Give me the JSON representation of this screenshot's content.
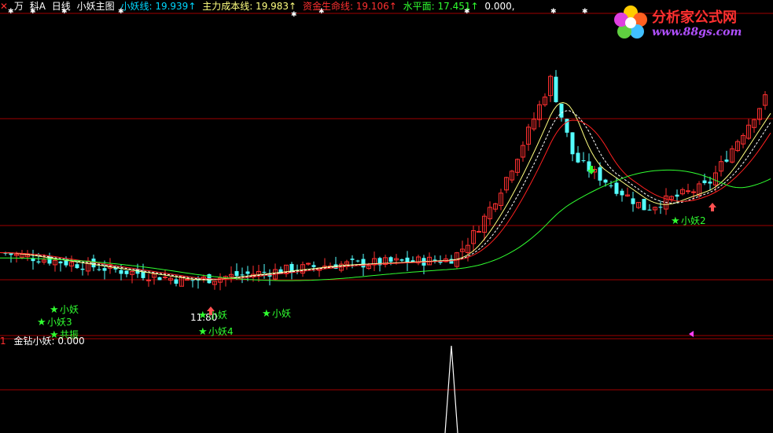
{
  "header": {
    "icon": "close-icon",
    "items": [
      {
        "text": "万",
        "color": "#ffffff"
      },
      {
        "text": "科A",
        "color": "#ffffff"
      },
      {
        "text": "日线",
        "color": "#ffffff"
      },
      {
        "text": "小妖主图",
        "color": "#ffffff"
      },
      {
        "text": "小妖线: 19.939↑",
        "color": "#00d8ff"
      },
      {
        "text": "主力成本线: 19.983↑",
        "color": "#ffff80"
      },
      {
        "text": "资金生命线: 19.106↑",
        "color": "#ff3030"
      },
      {
        "text": "水平面: 17.451↑",
        "color": "#30ff30"
      },
      {
        "text": "0.000,",
        "color": "#ffffff"
      }
    ]
  },
  "sub_panel": {
    "index": "1",
    "name": "金钻小妖: 0.000"
  },
  "logo": {
    "title": "分析家公式网",
    "url": "www.88gs.com"
  },
  "chart_data": {
    "type": "candlestick",
    "panels": [
      "main",
      "indicator"
    ],
    "price_range_approx": [
      9,
      27
    ],
    "series": [
      {
        "name": "小妖线",
        "color": "#ffff80"
      },
      {
        "name": "主力成本线",
        "color": "#ffffff"
      },
      {
        "name": "资金生命线",
        "color": "#ff2020"
      },
      {
        "name": "水平面",
        "color": "#30ff30"
      }
    ],
    "annotations": [
      {
        "text": "小妖"
      },
      {
        "text": "小妖3"
      },
      {
        "text": "共振"
      },
      {
        "text": "11.80"
      },
      {
        "text": "小妖"
      },
      {
        "text": "小妖4"
      },
      {
        "text": "小妖"
      },
      {
        "text": "小妖2"
      }
    ],
    "indicator": {
      "name": "金钻小妖",
      "value": 0.0
    }
  }
}
